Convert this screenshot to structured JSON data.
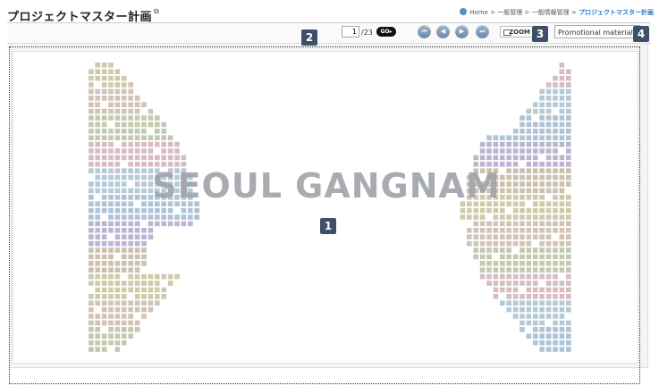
{
  "header": {
    "title": "プロジェクトマスター計画",
    "breadcrumb": [
      "Home",
      "一般管理",
      "一般情報管理",
      "プロジェクトマスター計画"
    ],
    "breadcrumb_separator": ">"
  },
  "toolbar": {
    "page_current": "1",
    "page_total": "/23",
    "go_label": "GO",
    "zoom_label": "ZOOM",
    "category_select": "Promotional material",
    "nav_first_icon": "first-page-icon",
    "nav_prev_icon": "previous-page-icon",
    "nav_next_icon": "next-page-icon",
    "nav_last_icon": "last-page-icon"
  },
  "slide": {
    "text": "SEOUL GANGNAM"
  },
  "badges": [
    "1",
    "2",
    "3",
    "4"
  ],
  "colors": {
    "badge_bg": "#3d5066",
    "nav_button": "#7a93b3",
    "breadcrumb_current": "#2c7ac1"
  }
}
